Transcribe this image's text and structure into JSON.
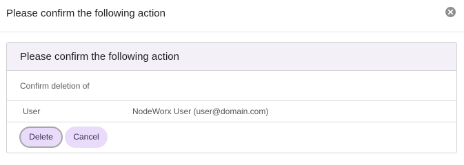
{
  "dialog": {
    "title": "Please confirm the following action",
    "close_icon": "close-icon"
  },
  "panel": {
    "heading": "Please confirm the following action",
    "subtitle": "Confirm deletion of",
    "details": [
      {
        "key": "User",
        "value": "NodeWorx User (user@domain.com)"
      }
    ]
  },
  "actions": {
    "delete_label": "Delete",
    "cancel_label": "Cancel"
  },
  "colors": {
    "button_bg": "#e9dcfa",
    "panel_heading_bg": "#f4f0f8",
    "close_icon_bg": "#8f8f8f"
  }
}
